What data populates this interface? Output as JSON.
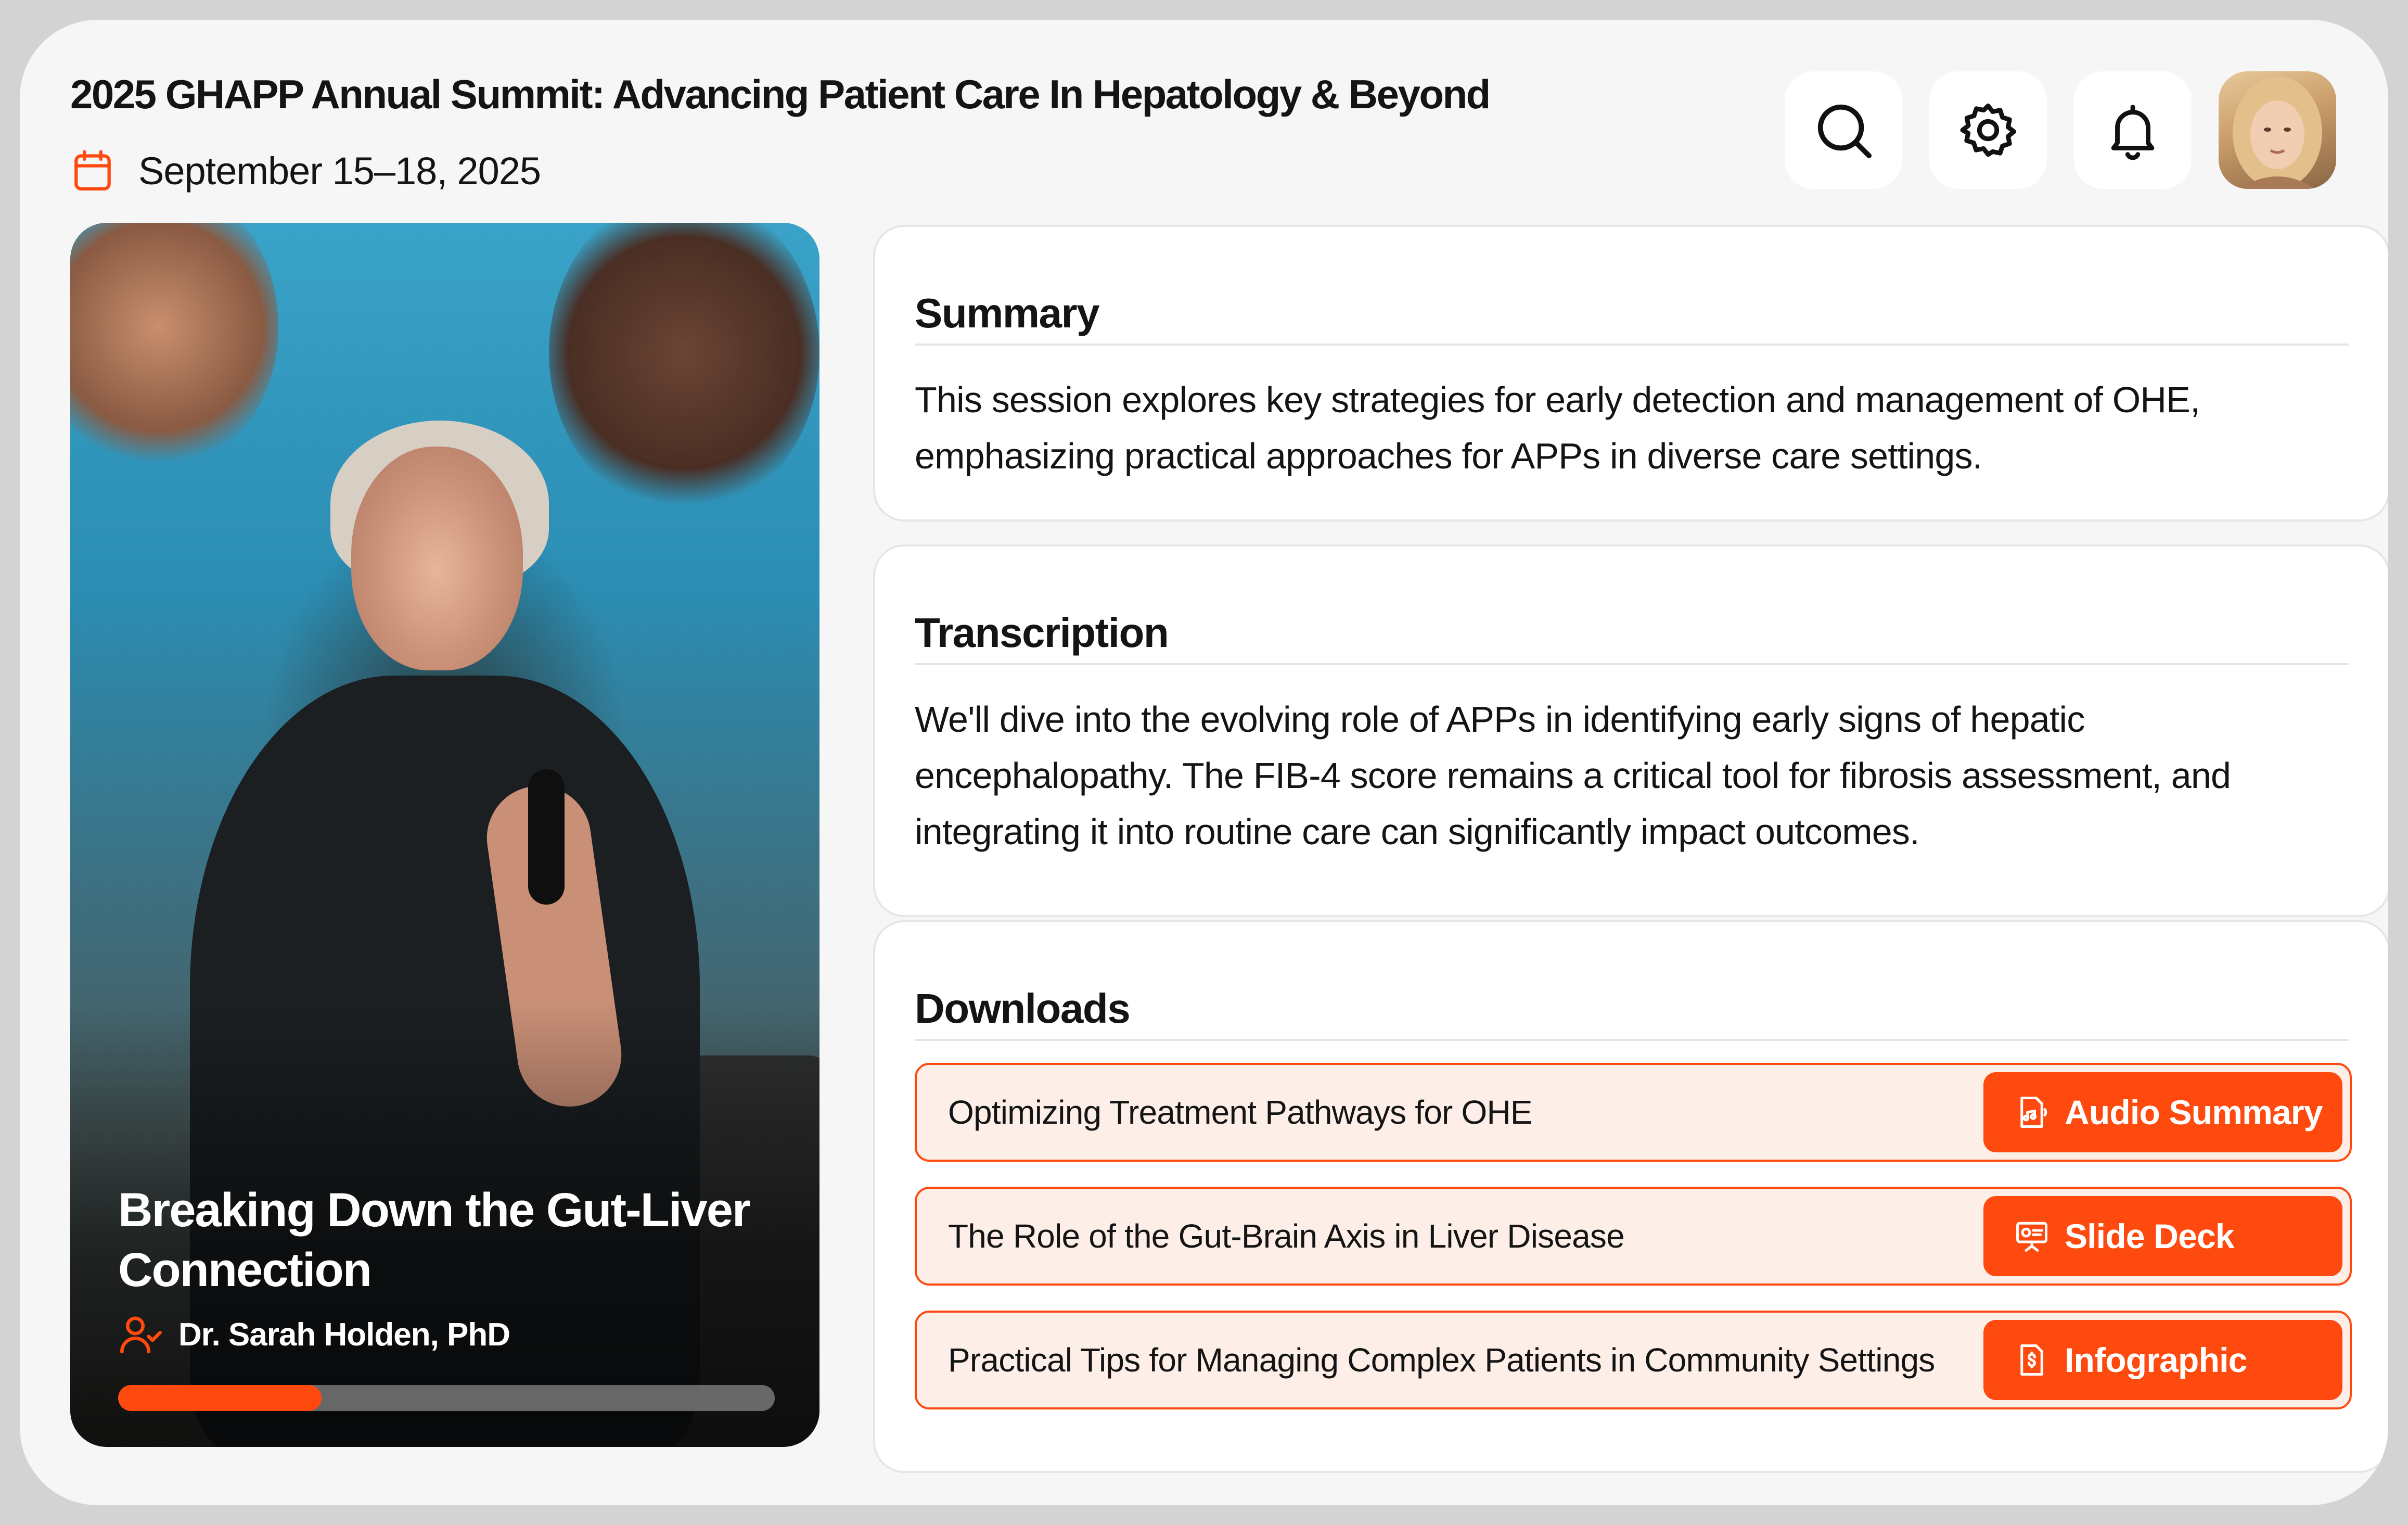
{
  "header": {
    "title": "2025 GHAPP Annual Summit: Advancing Patient Care In Hepatology & Beyond",
    "date": "September 15–18, 2025",
    "date_icon": "calendar-icon",
    "actions": [
      {
        "name": "search-button",
        "icon": "search-icon"
      },
      {
        "name": "settings-button",
        "icon": "gear-icon"
      },
      {
        "name": "notifications-button",
        "icon": "bell-icon"
      }
    ],
    "avatar": "user-avatar"
  },
  "session": {
    "title": "Breaking Down the Gut-Liver Connection",
    "speaker": "Dr. Sarah Holden, PhD",
    "speaker_icon": "user-check-icon",
    "progress": 0.31
  },
  "summary": {
    "heading": "Summary",
    "text": "This session explores key strategies for early detection and management of OHE, emphasizing practical approaches for APPs in diverse care settings."
  },
  "transcription": {
    "heading": "Transcription",
    "text": "We'll dive into the evolving role of APPs in identifying early signs of hepatic encephalopathy. The FIB-4 score remains a critical tool for fibrosis assessment, and integrating it into routine care can significantly impact outcomes."
  },
  "downloads": {
    "heading": "Downloads",
    "items": [
      {
        "title": "Optimizing Treatment Pathways for OHE",
        "button": "Audio Summary",
        "icon": "audio-file-icon"
      },
      {
        "title": "The Role of the Gut-Brain Axis in Liver Disease",
        "button": "Slide Deck",
        "icon": "presentation-icon"
      },
      {
        "title": "Practical Tips for Managing Complex Patients in Community Settings",
        "button": "Infographic",
        "icon": "infographic-file-icon"
      }
    ]
  },
  "colors": {
    "accent": "#ff4a0f",
    "accent_soft": "#fdeee8",
    "background": "#f6f6f6"
  }
}
